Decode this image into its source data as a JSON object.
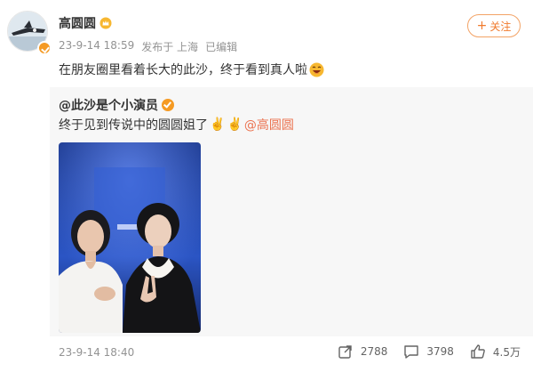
{
  "post": {
    "author": "高圆圆",
    "time": "23-9-14 18:59",
    "location": "发布于 上海",
    "edited": "已编辑",
    "follow_label": "关注",
    "text": "在朋友圈里看着长大的此沙，终于看到真人啦"
  },
  "repost": {
    "author": "@此沙是个小演员",
    "text": "终于见到传说中的圆圆姐了",
    "mention": "@高圆圆"
  },
  "footer": {
    "time": "23-9-14 18:40",
    "reposts": "2788",
    "comments": "3798",
    "likes": "4.5万"
  },
  "colors": {
    "accent": "#f07a2d",
    "mention": "#eb7350",
    "meta": "#939393",
    "repost_bg": "#f7f7f7"
  }
}
